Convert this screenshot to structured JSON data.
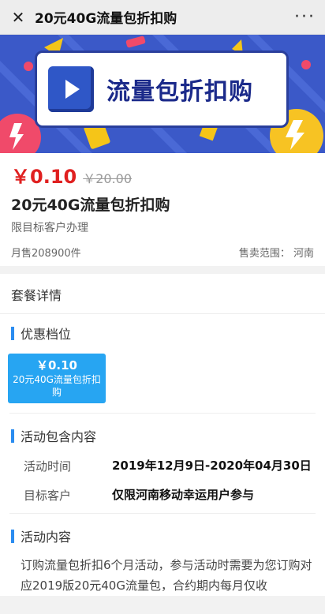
{
  "topbar": {
    "title": "20元40G流量包折扣购"
  },
  "banner": {
    "text": "流量包折扣购"
  },
  "product": {
    "price": "￥0.10",
    "original_price": "￥20.00",
    "name": "20元40G流量包折扣购",
    "subtitle": "限目标客户办理",
    "sales": "月售208900件",
    "region": "售卖范围：  河南"
  },
  "details": {
    "header": "套餐详情",
    "tier_title": "优惠档位",
    "tier": {
      "price": "￥0.10",
      "name": "20元40G流量包折扣购"
    },
    "activity_title": "活动包含内容",
    "rows": [
      {
        "label": "活动时间",
        "value": "2019年12月9日-2020年04月30日"
      },
      {
        "label": "目标客户",
        "value": "仅限河南移动幸运用户参与"
      }
    ],
    "content_title": "活动内容",
    "content_text": "订购流量包折扣6个月活动，参与活动时需要为您订购对应2019版20元40G流量包，合约期内每月仅收"
  },
  "colors": {
    "accent": "#2a8cf0",
    "price": "#e02020",
    "tier_bg": "#27a5f2",
    "banner_bg": "#3b59c8"
  }
}
